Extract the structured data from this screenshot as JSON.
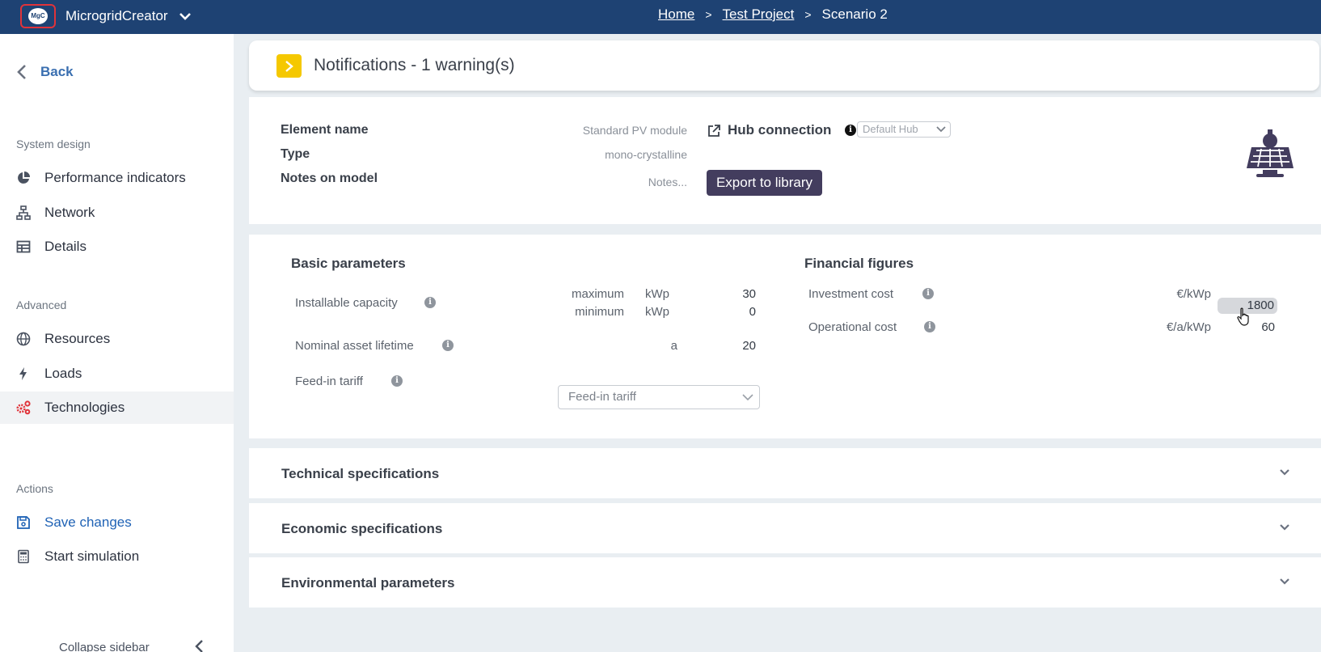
{
  "app": {
    "logo_text": "MgC",
    "name": "MicrogridCreator"
  },
  "breadcrumb": {
    "home": "Home",
    "project": "Test Project",
    "scenario": "Scenario 2",
    "separator": ">"
  },
  "sidebar": {
    "back": "Back",
    "system_design_label": "System design",
    "advanced_label": "Advanced",
    "actions_label": "Actions",
    "items": {
      "performance": "Performance indicators",
      "network": "Network",
      "details": "Details",
      "resources": "Resources",
      "loads": "Loads",
      "technologies": "Technologies",
      "save": "Save changes",
      "simulate": "Start simulation"
    },
    "collapse": "Collapse sidebar"
  },
  "notifications": {
    "title": "Notifications - 1 warning(s)"
  },
  "element": {
    "name_label": "Element name",
    "name_value": "Standard PV module",
    "type_label": "Type",
    "type_value": "mono-crystalline",
    "notes_label": "Notes on model",
    "notes_value": "Notes...",
    "hub_label": "Hub connection",
    "hub_value": "Default Hub",
    "export_label": "Export to library"
  },
  "basic": {
    "title": "Basic parameters",
    "capacity_label": "Installable capacity",
    "max_label": "maximum",
    "min_label": "minimum",
    "capacity_unit": "kWp",
    "max_value": "30",
    "min_value": "0",
    "lifetime_label": "Nominal asset lifetime",
    "lifetime_unit": "a",
    "lifetime_value": "20",
    "tariff_label": "Feed-in tariff",
    "tariff_placeholder": "Feed-in tariff"
  },
  "financial": {
    "title": "Financial figures",
    "investment_label": "Investment cost",
    "investment_unit": "€/kWp",
    "investment_value": "1800",
    "operational_label": "Operational cost",
    "operational_unit": "€/a/kWp",
    "operational_value": "60"
  },
  "accordions": {
    "technical": "Technical specifications",
    "economic": "Economic specifications",
    "environmental": "Environmental parameters"
  },
  "colors": {
    "topbar": "#1e4273",
    "accent_red": "#e0333a",
    "warning_yellow": "#f5c800",
    "export_button": "#433d5e",
    "link_blue": "#1f62b5"
  }
}
